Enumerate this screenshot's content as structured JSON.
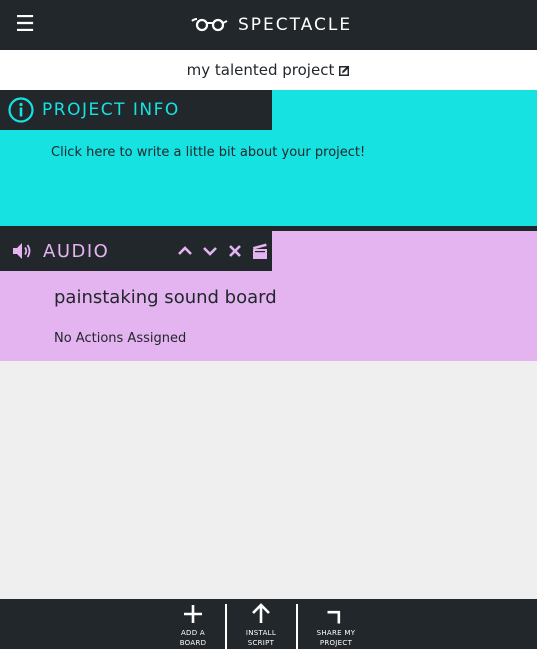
{
  "topbar": {
    "menu_icon": "hamburger-icon",
    "brand_icon": "glasses-icon",
    "brand_name": "SPECTACLE"
  },
  "project": {
    "title": "my talented project",
    "edit_icon": "edit-icon"
  },
  "info": {
    "icon": "info-icon",
    "title": "PROJECT INFO",
    "description": "Click here to write a little bit about your project!"
  },
  "audio": {
    "icon": "speaker-icon",
    "title": "AUDIO",
    "controls": [
      "chevron-up-icon",
      "chevron-down-icon",
      "close-icon",
      "clapperboard-icon"
    ],
    "board_name": "painstaking sound board",
    "status": "No Actions Assigned"
  },
  "bottom": {
    "add_board": "ADD A\nBOARD",
    "install_script": "INSTALL\nSCRIPT",
    "share_project": "SHARE MY\nPROJECT"
  },
  "colors": {
    "dark": "#22272b",
    "cyan": "#16e2e2",
    "lavender": "#e3b4f0",
    "background": "#efefef"
  }
}
